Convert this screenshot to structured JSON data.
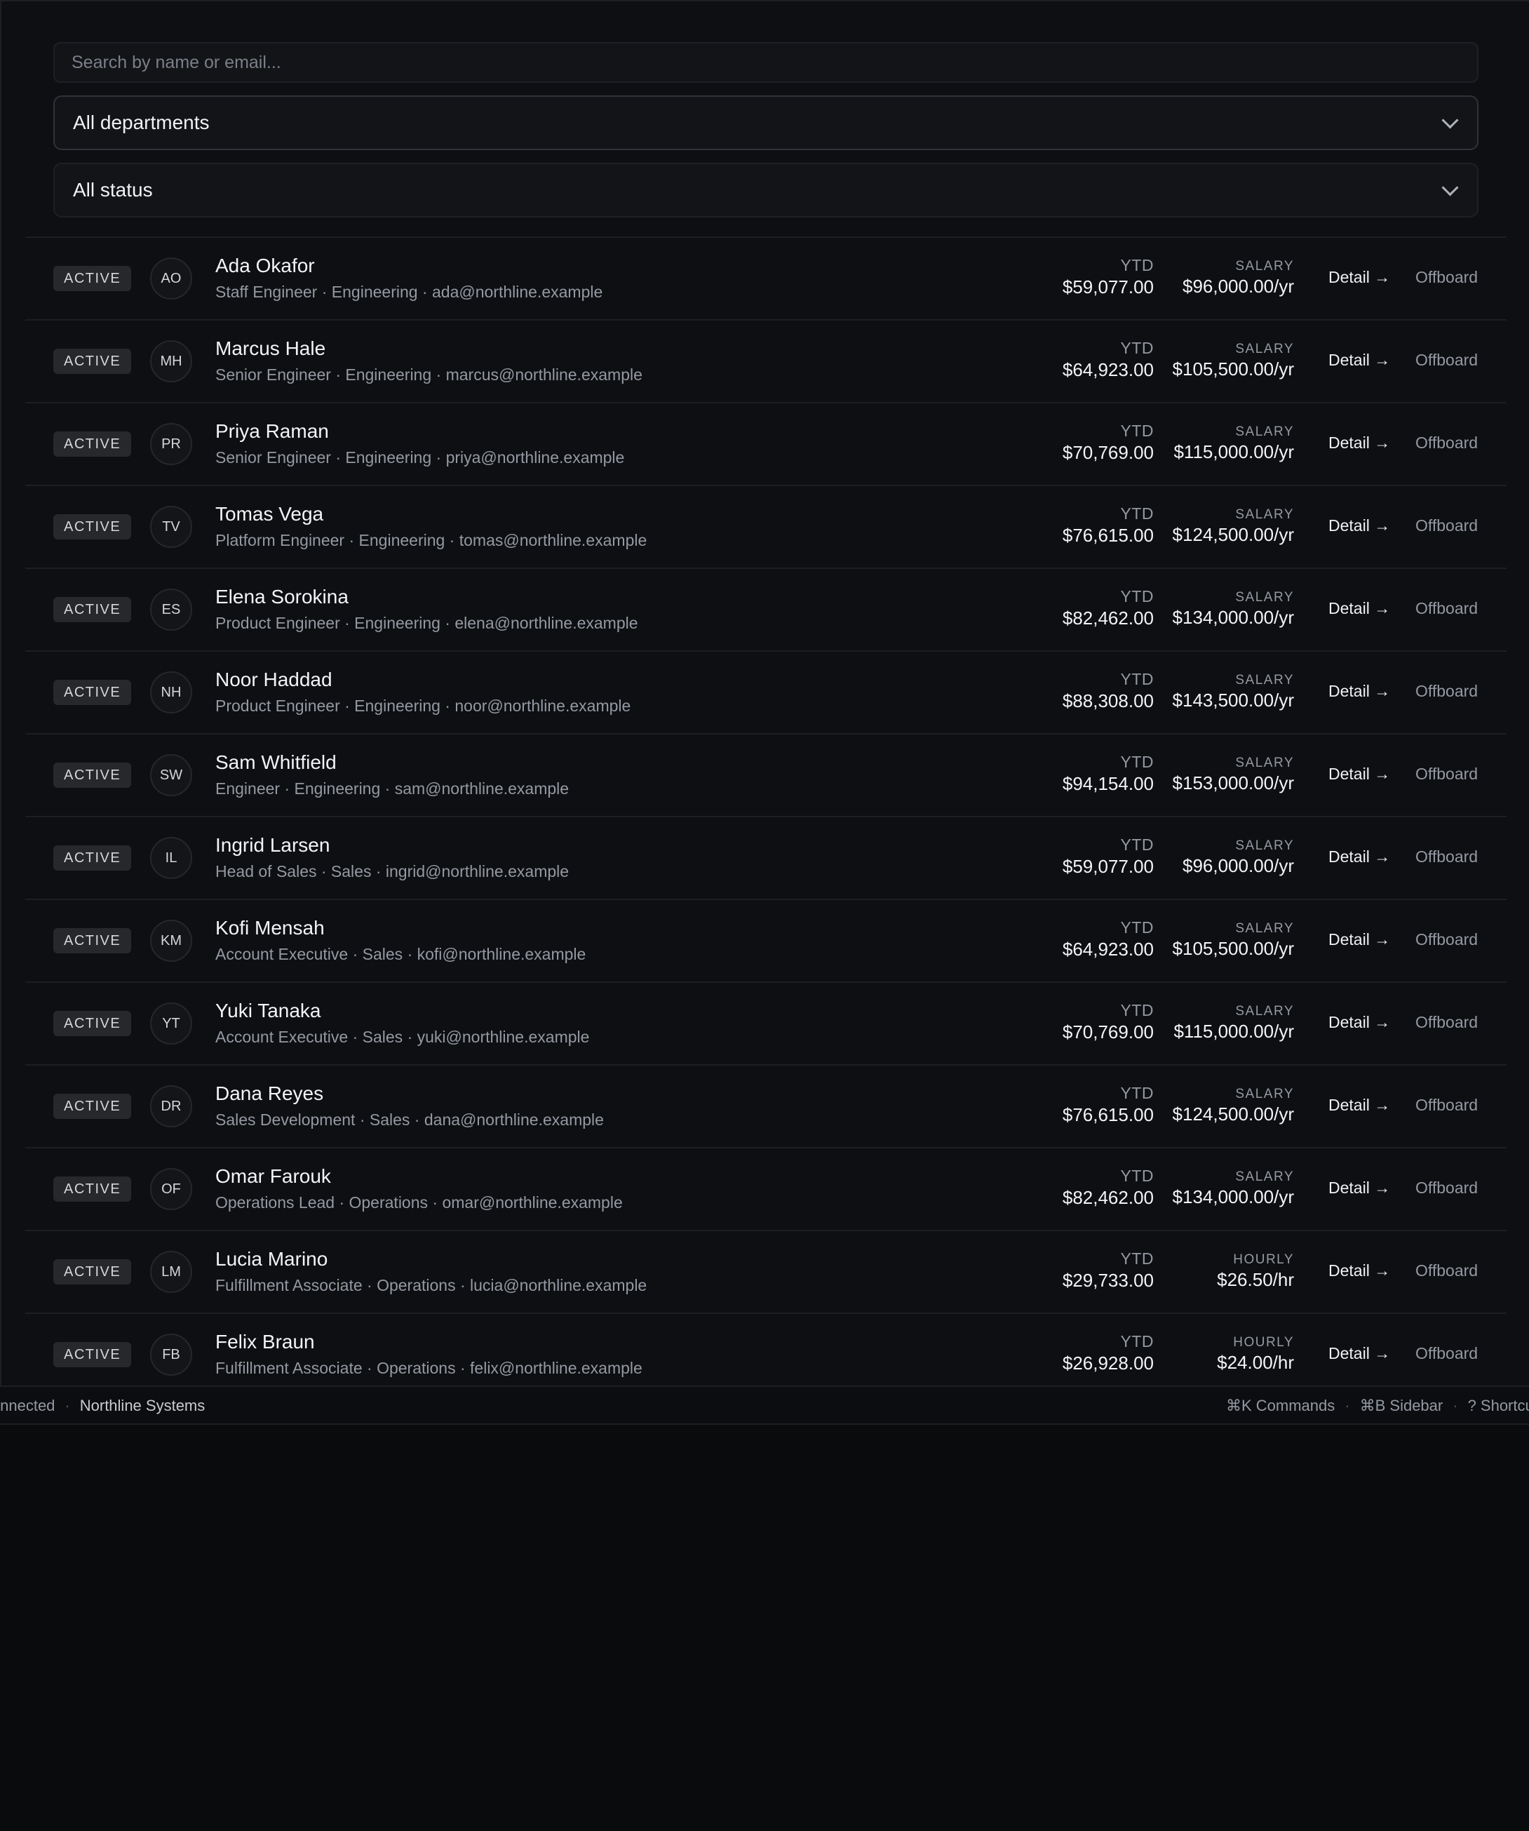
{
  "filters": {
    "search_placeholder": "Search by name or email...",
    "department": "All departments",
    "status": "All status"
  },
  "employees": [
    {
      "status": "ACTIVE",
      "initials": "AO",
      "name": "Ada Okafor",
      "meta": "Staff Engineer · Engineering · ada@northline.example",
      "ytd_label": "YTD",
      "ytd": "$59,077.00",
      "pay_label": "SALARY",
      "pay": "$96,000.00/yr",
      "detail": "Detail →",
      "offboard": "Offboard"
    },
    {
      "status": "ACTIVE",
      "initials": "MH",
      "name": "Marcus Hale",
      "meta": "Senior Engineer · Engineering · marcus@northline.example",
      "ytd_label": "YTD",
      "ytd": "$64,923.00",
      "pay_label": "SALARY",
      "pay": "$105,500.00/yr",
      "detail": "Detail →",
      "offboard": "Offboard"
    },
    {
      "status": "ACTIVE",
      "initials": "PR",
      "name": "Priya Raman",
      "meta": "Senior Engineer · Engineering · priya@northline.example",
      "ytd_label": "YTD",
      "ytd": "$70,769.00",
      "pay_label": "SALARY",
      "pay": "$115,000.00/yr",
      "detail": "Detail →",
      "offboard": "Offboard"
    },
    {
      "status": "ACTIVE",
      "initials": "TV",
      "name": "Tomas Vega",
      "meta": "Platform Engineer · Engineering · tomas@northline.example",
      "ytd_label": "YTD",
      "ytd": "$76,615.00",
      "pay_label": "SALARY",
      "pay": "$124,500.00/yr",
      "detail": "Detail →",
      "offboard": "Offboard"
    },
    {
      "status": "ACTIVE",
      "initials": "ES",
      "name": "Elena Sorokina",
      "meta": "Product Engineer · Engineering · elena@northline.example",
      "ytd_label": "YTD",
      "ytd": "$82,462.00",
      "pay_label": "SALARY",
      "pay": "$134,000.00/yr",
      "detail": "Detail →",
      "offboard": "Offboard"
    },
    {
      "status": "ACTIVE",
      "initials": "NH",
      "name": "Noor Haddad",
      "meta": "Product Engineer · Engineering · noor@northline.example",
      "ytd_label": "YTD",
      "ytd": "$88,308.00",
      "pay_label": "SALARY",
      "pay": "$143,500.00/yr",
      "detail": "Detail →",
      "offboard": "Offboard"
    },
    {
      "status": "ACTIVE",
      "initials": "SW",
      "name": "Sam Whitfield",
      "meta": "Engineer · Engineering · sam@northline.example",
      "ytd_label": "YTD",
      "ytd": "$94,154.00",
      "pay_label": "SALARY",
      "pay": "$153,000.00/yr",
      "detail": "Detail →",
      "offboard": "Offboard"
    },
    {
      "status": "ACTIVE",
      "initials": "IL",
      "name": "Ingrid Larsen",
      "meta": "Head of Sales · Sales · ingrid@northline.example",
      "ytd_label": "YTD",
      "ytd": "$59,077.00",
      "pay_label": "SALARY",
      "pay": "$96,000.00/yr",
      "detail": "Detail →",
      "offboard": "Offboard"
    },
    {
      "status": "ACTIVE",
      "initials": "KM",
      "name": "Kofi Mensah",
      "meta": "Account Executive · Sales · kofi@northline.example",
      "ytd_label": "YTD",
      "ytd": "$64,923.00",
      "pay_label": "SALARY",
      "pay": "$105,500.00/yr",
      "detail": "Detail →",
      "offboard": "Offboard"
    },
    {
      "status": "ACTIVE",
      "initials": "YT",
      "name": "Yuki Tanaka",
      "meta": "Account Executive · Sales · yuki@northline.example",
      "ytd_label": "YTD",
      "ytd": "$70,769.00",
      "pay_label": "SALARY",
      "pay": "$115,000.00/yr",
      "detail": "Detail →",
      "offboard": "Offboard"
    },
    {
      "status": "ACTIVE",
      "initials": "DR",
      "name": "Dana Reyes",
      "meta": "Sales Development · Sales · dana@northline.example",
      "ytd_label": "YTD",
      "ytd": "$76,615.00",
      "pay_label": "SALARY",
      "pay": "$124,500.00/yr",
      "detail": "Detail →",
      "offboard": "Offboard"
    },
    {
      "status": "ACTIVE",
      "initials": "OF",
      "name": "Omar Farouk",
      "meta": "Operations Lead · Operations · omar@northline.example",
      "ytd_label": "YTD",
      "ytd": "$82,462.00",
      "pay_label": "SALARY",
      "pay": "$134,000.00/yr",
      "detail": "Detail →",
      "offboard": "Offboard"
    },
    {
      "status": "ACTIVE",
      "initials": "LM",
      "name": "Lucia Marino",
      "meta": "Fulfillment Associate · Operations · lucia@northline.example",
      "ytd_label": "YTD",
      "ytd": "$29,733.00",
      "pay_label": "HOURLY",
      "pay": "$26.50/hr",
      "detail": "Detail →",
      "offboard": "Offboard"
    },
    {
      "status": "ACTIVE",
      "initials": "FB",
      "name": "Felix Braun",
      "meta": "Fulfillment Associate · Operations · felix@northline.example",
      "ytd_label": "YTD",
      "ytd": "$26,928.00",
      "pay_label": "HOURLY",
      "pay": "$24.00/hr",
      "detail": "Detail →",
      "offboard": "Offboard"
    }
  ],
  "statusbar": {
    "connection": "Connected",
    "company": "Northline Systems",
    "commands": "⌘K Commands",
    "sidebar": "⌘B Sidebar",
    "shortcuts": "? Shortcuts"
  },
  "colors": {
    "background": "#0a0b0d",
    "panel": "#0e0f12",
    "badge": "#26282c",
    "muted_text": "#9499a2"
  }
}
